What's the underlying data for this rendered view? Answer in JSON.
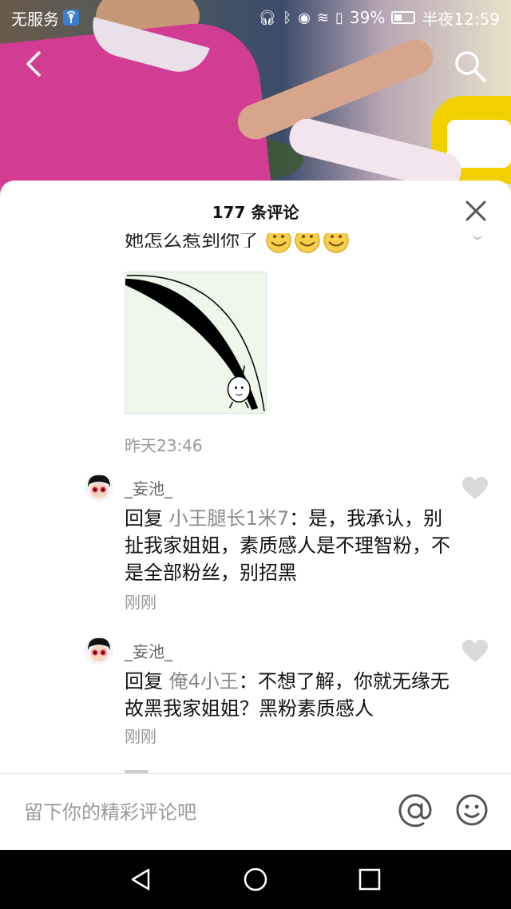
{
  "status_bar": {
    "carrier": "无服务",
    "battery": "39%",
    "time": "半夜12:59"
  },
  "comments_sheet": {
    "title": "177 条评论",
    "partial_comment_text": "她怎么惹到你了",
    "partial_comment_time": "昨天23:46",
    "replies": [
      {
        "username": "_妄池_",
        "reply_prefix": "回复 ",
        "reply_target": "小王腿长1米7",
        "reply_text": "：是，我承认，别扯我家姐姐，素质感人是不理智粉，不是全部粉丝，别招黑",
        "time": "刚刚"
      },
      {
        "username": "_妄池_",
        "reply_prefix": "回复 ",
        "reply_target": "俺4小王",
        "reply_text": "：不想了解，你就无缘无故黑我家姐姐？黑粉素质感人",
        "time": "刚刚"
      }
    ]
  },
  "input_bar": {
    "placeholder": "留下你的精彩评论吧"
  },
  "icons": {
    "back": "chevron-left-icon",
    "search": "search-icon",
    "close": "close-icon",
    "like": "heart-icon",
    "mention": "at-icon",
    "emoji": "smiley-icon",
    "nav_back": "triangle-back-icon",
    "nav_home": "circle-home-icon",
    "nav_recent": "square-recent-icon"
  },
  "colors": {
    "sheet_bg": "#ffffff",
    "secondary_text": "#999999",
    "mention_text": "#8a8a8a"
  }
}
